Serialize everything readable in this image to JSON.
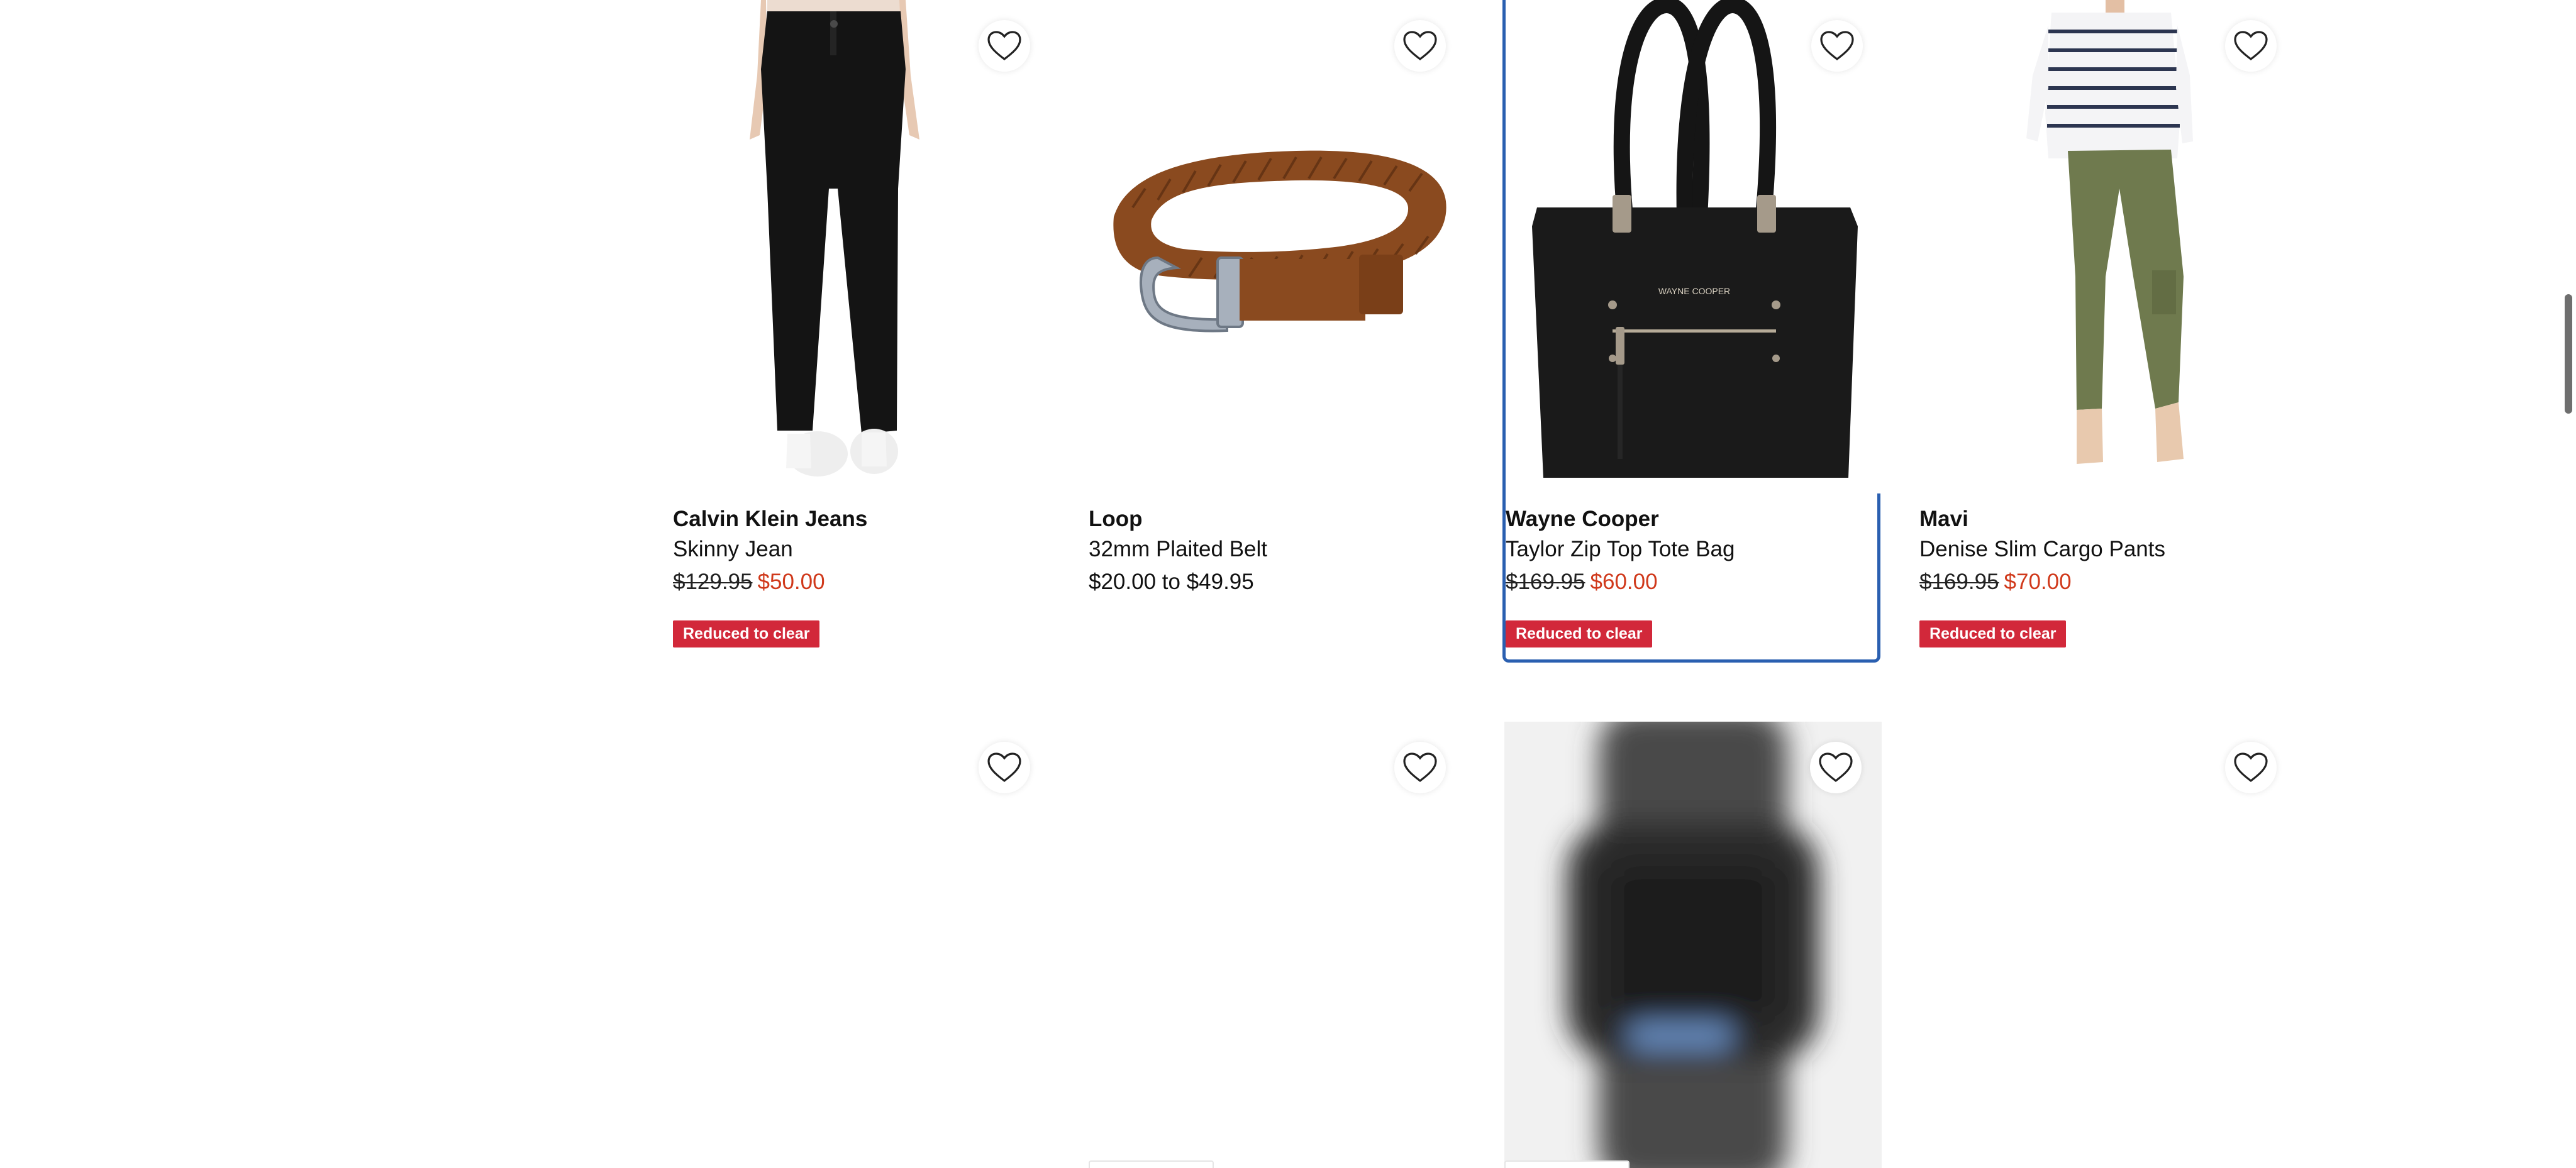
{
  "products": [
    {
      "brand": "Calvin Klein Jeans",
      "name": "Skinny Jean",
      "price_was": "$129.95",
      "price_now": "$50.00",
      "badge": "Reduced to clear",
      "image": "black-skinny-jean"
    },
    {
      "brand": "Loop",
      "name": "32mm Plaited Belt",
      "price_range": "$20.00 to $49.95",
      "image": "brown-plaited-belt"
    },
    {
      "brand": "Wayne Cooper",
      "name": "Taylor Zip Top Tote Bag",
      "price_was": "$169.95",
      "price_now": "$60.00",
      "badge": "Reduced to clear",
      "image": "black-tote-bag",
      "image_text": "WAYNE COOPER",
      "highlighted": true
    },
    {
      "brand": "Mavi",
      "name": "Denise Slim Cargo Pants",
      "price_was": "$169.95",
      "price_now": "$70.00",
      "badge": "Reduced to clear",
      "image": "olive-cargo-pants"
    }
  ],
  "row2": [
    {
      "image": "loading-placeholder"
    },
    {
      "image": "loading-placeholder"
    },
    {
      "image": "blurred-smartwatch"
    },
    {
      "image": "loading-placeholder"
    }
  ],
  "icons": {
    "wishlist": "heart-outline-icon"
  },
  "colors": {
    "sale_price": "#d0391b",
    "badge_bg": "#d2283a",
    "focus_border": "#2a5fb0"
  }
}
